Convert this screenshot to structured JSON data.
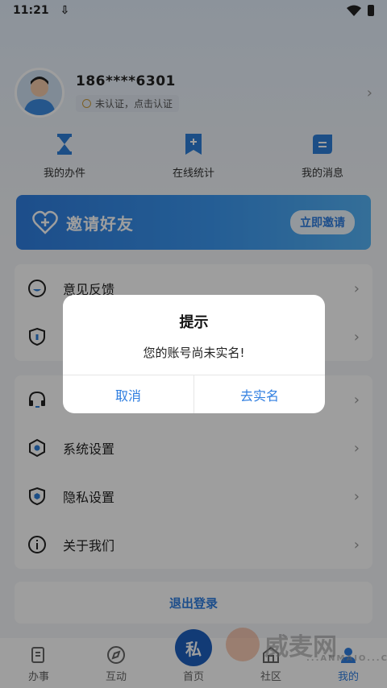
{
  "status_bar": {
    "time": "11:21"
  },
  "profile": {
    "phone": "186****6301",
    "auth_text": "未认证，点击认证"
  },
  "quick_actions": [
    {
      "label": "我的办件",
      "icon": "hourglass-icon"
    },
    {
      "label": "在线统计",
      "icon": "bookmark-plus-icon"
    },
    {
      "label": "我的消息",
      "icon": "message-icon"
    }
  ],
  "invite": {
    "title": "邀请好友",
    "button": "立即邀请"
  },
  "menu": [
    {
      "label": "意见反馈",
      "icon": "feedback-icon"
    },
    {
      "label": "",
      "icon": "lock-shield-icon"
    },
    {
      "label": "",
      "icon": "headset-icon"
    },
    {
      "label": "系统设置",
      "icon": "settings-hex-icon"
    },
    {
      "label": "隐私设置",
      "icon": "privacy-shield-icon"
    },
    {
      "label": "关于我们",
      "icon": "info-icon"
    }
  ],
  "logout_label": "退出登录",
  "tabs": [
    {
      "label": "办事",
      "icon": "tasks-icon"
    },
    {
      "label": "互动",
      "icon": "compass-icon"
    },
    {
      "label": "首页",
      "icon": "home-logo-icon"
    },
    {
      "label": "社区",
      "icon": "community-icon"
    },
    {
      "label": "我的",
      "icon": "profile-icon",
      "active": true
    }
  ],
  "dialog": {
    "title": "提示",
    "message": "您的账号尚未实名!",
    "cancel": "取消",
    "confirm": "去实名"
  },
  "watermark": {
    "text": "威麦网",
    "sub": "...ANMAIO...COM"
  },
  "colors": {
    "accent": "#2f7ee0",
    "overlay": "rgba(0,0,0,0.38)"
  }
}
